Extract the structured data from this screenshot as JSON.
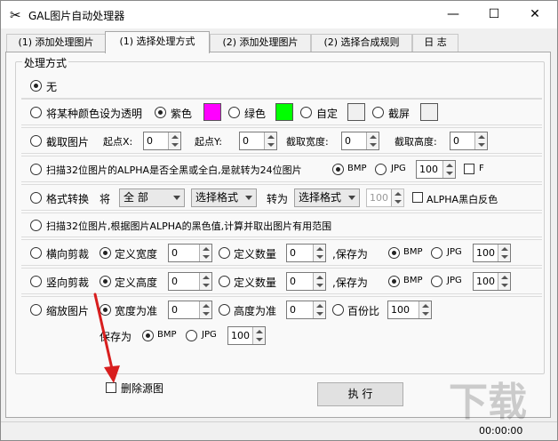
{
  "window": {
    "title": "GAL图片自动处理器",
    "app_icon": "scissors-icon",
    "minimize": "—",
    "maximize": "☐",
    "close": "✕"
  },
  "tabs": [
    "(1) 添加处理图片",
    "(1) 选择处理方式",
    "(2) 添加处理图片",
    "(2) 选择合成规则",
    "日 志"
  ],
  "group_title": "处理方式",
  "rows": {
    "none": {
      "label": "无"
    },
    "transparent": {
      "label": "将某种颜色设为透明",
      "purple": "紫色",
      "green": "绿色",
      "custom": "自定",
      "screen": "截屏",
      "purple_color": "#ff00ff",
      "green_color": "#00ff00"
    },
    "crop": {
      "label": "截取图片",
      "start_x": "起点X:",
      "x_val": "0",
      "start_y": "起点Y:",
      "y_val": "0",
      "width": "截取宽度:",
      "w_val": "0",
      "height": "截取高度:",
      "h_val": "0"
    },
    "alpha24": {
      "label": "扫描32位图片的ALPHA是否全黑或全白,是就转为24位图片",
      "bmp": "BMP",
      "jpg": "JPG",
      "q_val": "100",
      "f": "F"
    },
    "format": {
      "label": "格式转换",
      "jiang": "将",
      "all": "全 部",
      "select1": "选择格式",
      "zhuanwei": "转为",
      "select2": "选择格式",
      "q_val": "100",
      "alpha_invert": "ALPHA黑白反色"
    },
    "scan_range": {
      "label": "扫描32位图片,根据图片ALPHA的黑色值,计算并取出图片有用范围"
    },
    "hcut": {
      "label": "横向剪裁",
      "define_width": "定义宽度",
      "w_val": "0",
      "define_count": "定义数量",
      "c_val": "0",
      "save_as": ",保存为",
      "bmp": "BMP",
      "jpg": "JPG",
      "q_val": "100"
    },
    "vcut": {
      "label": "竖向剪裁",
      "define_height": "定义高度",
      "h_val": "0",
      "define_count": "定义数量",
      "c_val": "0",
      "save_as": ",保存为",
      "bmp": "BMP",
      "jpg": "JPG",
      "q_val": "100"
    },
    "scale": {
      "label": "缩放图片",
      "by_width": "宽度为准",
      "w_val": "0",
      "by_height": "高度为准",
      "h_val": "0",
      "percent": "百份比",
      "p_val": "100",
      "save_as": "保存为",
      "bmp": "BMP",
      "jpg": "JPG",
      "q_val": "100"
    }
  },
  "delete_source": "删除源图",
  "execute": "执 行",
  "status_time": "00:00:00",
  "accent_colors": {
    "annotation_arrow": "#d81e1e"
  }
}
